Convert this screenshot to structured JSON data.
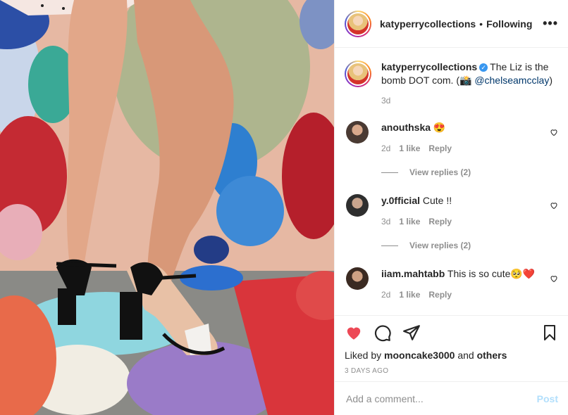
{
  "post": {
    "username": "katyperrycollections",
    "following_label": "Following",
    "separator": "•",
    "more": "•••",
    "caption_text": "The Liz is the bomb DOT com. (📸",
    "caption_mention": "@chelseamcclay",
    "caption_close": ")",
    "caption_time": "3d",
    "liked_prefix": "Liked by",
    "liked_user": "mooncake3000",
    "liked_and": "and",
    "liked_others": "others",
    "date": "3 DAYS AGO"
  },
  "comments": [
    {
      "user": "anouthska",
      "text": "😍",
      "time": "2d",
      "likes": "1 like",
      "reply": "Reply",
      "view_replies": "View replies (2)"
    },
    {
      "user": "y.0fficial",
      "text": "Cute !!",
      "time": "3d",
      "likes": "1 like",
      "reply": "Reply",
      "view_replies": "View replies (2)"
    },
    {
      "user": "iiam.mahtabb",
      "text": "This is so cute🥺❤️",
      "time": "2d",
      "likes": "1 like",
      "reply": "Reply"
    }
  ],
  "input": {
    "placeholder": "Add a comment...",
    "post_label": "Post"
  },
  "colors": {
    "like_red": "#ed4956",
    "link": "#00376b",
    "muted": "#8e8e8e",
    "post_disabled": "#b2dffc"
  },
  "icons": [
    "heart-icon",
    "comment-icon",
    "share-icon",
    "bookmark-icon",
    "verified-icon",
    "more-icon"
  ]
}
